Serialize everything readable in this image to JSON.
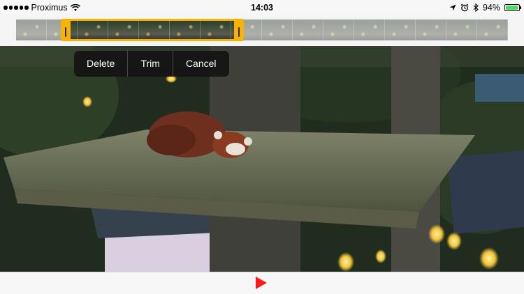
{
  "status_bar": {
    "carrier": "Proximus",
    "time": "14:03",
    "battery_percent": "94%",
    "battery_level": 0.94,
    "icons": [
      "signal-dots-icon",
      "wifi-icon",
      "location-arrow-icon",
      "alarm-clock-icon",
      "bluetooth-icon",
      "battery-icon"
    ]
  },
  "trim_bar": {
    "frame_count": 16,
    "accent_color": "#f9b200"
  },
  "edit_menu": {
    "items": [
      {
        "label": "Delete"
      },
      {
        "label": "Trim"
      },
      {
        "label": "Cancel"
      }
    ]
  },
  "playback": {
    "play_icon": "play-icon",
    "play_color": "#ff1a1a"
  }
}
